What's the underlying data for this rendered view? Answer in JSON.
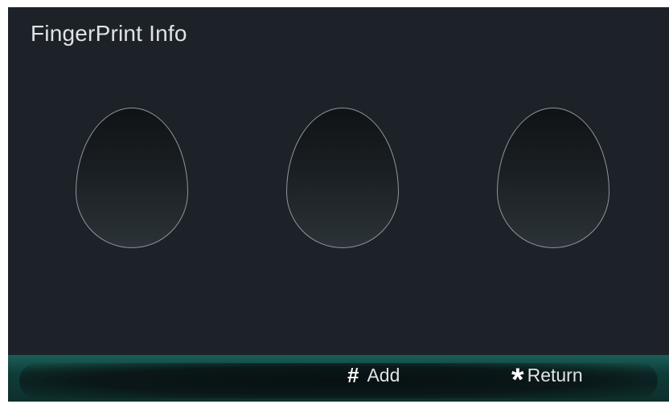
{
  "screen": {
    "title": "FingerPrint Info"
  },
  "slots": [
    {
      "name": "fingerprint-slot-1"
    },
    {
      "name": "fingerprint-slot-2"
    },
    {
      "name": "fingerprint-slot-3"
    }
  ],
  "bottom_bar": {
    "add_key": "#",
    "add_label": "Add",
    "return_key": "*",
    "return_label": "Return"
  },
  "colors": {
    "background": "#1d2228",
    "bar_accent": "#1b5f58",
    "text": "#dfe3e6"
  }
}
